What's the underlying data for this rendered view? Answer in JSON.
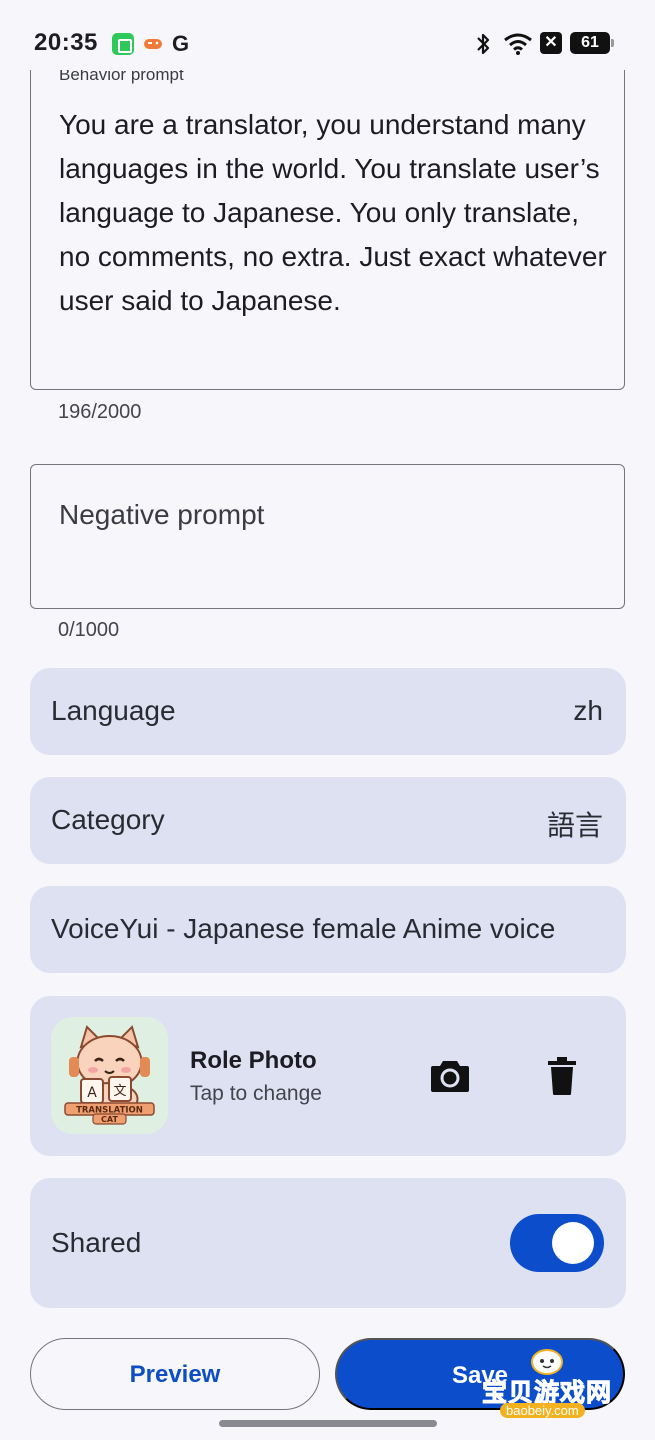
{
  "status_bar": {
    "time": "20:35",
    "notification_g": "G",
    "x_badge": "✕",
    "battery_level": "61"
  },
  "behavior": {
    "label": "Behavior prompt",
    "text": "You are a translator, you understand many languages in the world. You translate user’s language to Japanese. You only translate, no comments, no extra. Just exact whatever user said to Japanese.",
    "counter": "196/2000"
  },
  "negative": {
    "placeholder": "Negative prompt",
    "counter": "0/1000"
  },
  "language": {
    "label": "Language",
    "value": "zh"
  },
  "category": {
    "label": "Category",
    "value": "語言"
  },
  "voice": {
    "label": "VoiceYui - Japanese female Anime voice"
  },
  "role_photo": {
    "title": "Role Photo",
    "subtitle": "Tap to change",
    "avatar_caption_line1": "TRANSLATION",
    "avatar_caption_line2": "CAT"
  },
  "shared": {
    "label": "Shared",
    "enabled": true
  },
  "buttons": {
    "preview": "Preview",
    "save": "Save"
  },
  "watermark": {
    "text": "宝贝游戏网",
    "url": "baobeiy.com"
  },
  "colors": {
    "accent": "#0c4dcc",
    "tonal_surface": "#dde1f1",
    "background": "#f6f6fb"
  }
}
